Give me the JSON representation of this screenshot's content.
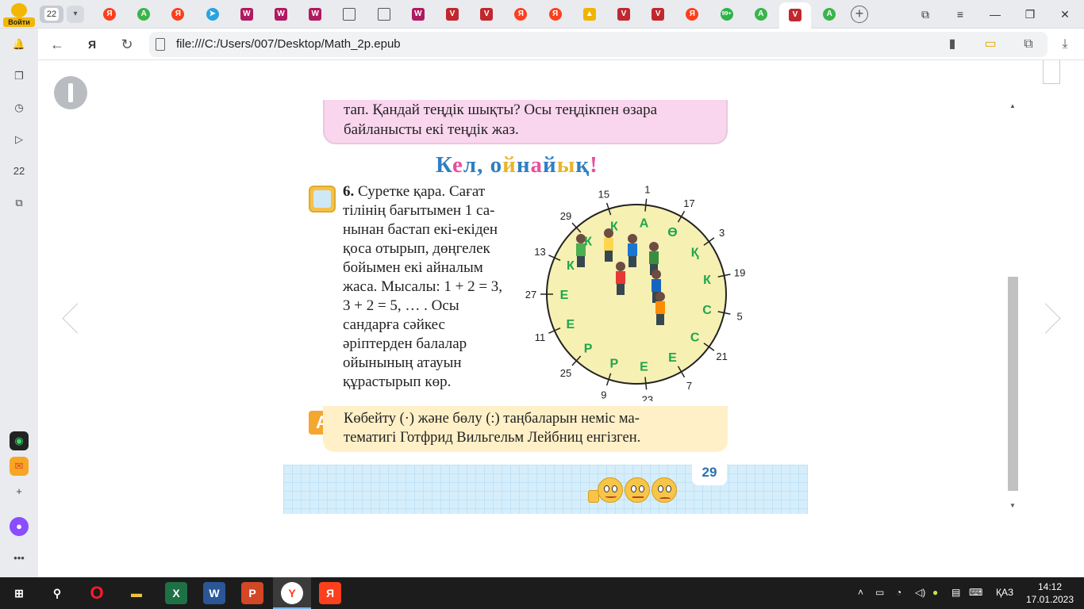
{
  "browser": {
    "login_label": "Войти",
    "tab_count": "22",
    "url": "file:///C:/Users/007/Desktop/Math_2p.epub"
  },
  "tabs": [
    {
      "icon": "yandex-icon",
      "glyph": "Я"
    },
    {
      "icon": "green-a-icon",
      "glyph": "A"
    },
    {
      "icon": "yandex-icon",
      "glyph": "Я"
    },
    {
      "icon": "telegram-icon",
      "glyph": "➤"
    },
    {
      "icon": "magenta-doc-icon",
      "glyph": "W"
    },
    {
      "icon": "magenta-doc-icon",
      "glyph": "W"
    },
    {
      "icon": "magenta-doc-icon",
      "glyph": "W"
    },
    {
      "icon": "document-icon",
      "glyph": ""
    },
    {
      "icon": "document-icon",
      "glyph": ""
    },
    {
      "icon": "magenta-doc-icon",
      "glyph": "W"
    },
    {
      "icon": "red-shield-icon",
      "glyph": "V"
    },
    {
      "icon": "red-shield-icon",
      "glyph": "V"
    },
    {
      "icon": "yandex-icon",
      "glyph": "Я"
    },
    {
      "icon": "yandex-icon",
      "glyph": "Я"
    },
    {
      "icon": "image-icon",
      "glyph": "▲"
    },
    {
      "icon": "red-shield-icon",
      "glyph": "V"
    },
    {
      "icon": "red-shield-icon",
      "glyph": "V"
    },
    {
      "icon": "yandex-icon",
      "glyph": "Я"
    },
    {
      "icon": "whatsapp-icon",
      "glyph": "99+"
    },
    {
      "icon": "green-a-icon",
      "glyph": "A"
    },
    {
      "icon": "red-shield-icon",
      "glyph": "V",
      "active": true
    },
    {
      "icon": "green-a-icon",
      "glyph": "A"
    }
  ],
  "sidebar": {
    "items": [
      {
        "icon": "bell-icon",
        "glyph": "🔔"
      },
      {
        "icon": "collections-icon",
        "glyph": "❐"
      },
      {
        "icon": "history-icon",
        "glyph": "◷"
      },
      {
        "icon": "play-icon",
        "glyph": "▷"
      },
      {
        "icon": "tabs-count-icon",
        "glyph": "22"
      },
      {
        "icon": "screenshot-icon",
        "glyph": "⧉"
      }
    ],
    "bottom": [
      {
        "icon": "app-icon",
        "glyph": "◉"
      },
      {
        "icon": "mail-icon",
        "glyph": "✉"
      },
      {
        "icon": "add-icon",
        "glyph": "+"
      },
      {
        "icon": "alice-icon",
        "glyph": "●"
      },
      {
        "icon": "more-icon",
        "glyph": "•••"
      }
    ]
  },
  "book": {
    "pink_box": {
      "line1": "тап. Қандай теңдік шықты? Осы теңдікпен өзара",
      "line2": "байланысты екі теңдік жаз."
    },
    "task_title": "Кел, ойнайық!",
    "task_number": "6.",
    "task_lines": [
      "Суретке қара. Сағат",
      "тілінің бағытымен 1 са-",
      "нынан бастап екі-екіден",
      "қоса отырып, дөңгелек",
      "бойымен екі айналым",
      "жаса. Мысалы: 1 + 2 = 3,",
      " 3 + 2 = 5, … . Осы",
      "сандарға сәйкес",
      "әріптерден балалар",
      "ойынының атауын",
      "құрастырып көр."
    ],
    "wheel": {
      "numbers": [
        "1",
        "17",
        "3",
        "19",
        "5",
        "21",
        "7",
        "23",
        "9",
        "25",
        "11",
        "27",
        "13",
        "29",
        "15"
      ],
      "letters": [
        "А",
        "Ө",
        "Қ",
        "К",
        "С",
        "С",
        "Е",
        "Е",
        "Р",
        "Р",
        "Е",
        "Е",
        "К",
        "К",
        "К"
      ]
    },
    "fact_icon": "A",
    "fact_lines": [
      "Көбейту (·) және бөлу (:) таңбаларын неміс ма-",
      "тематигі Готфрид Вильгельм Лейбниц енгізген."
    ],
    "page_number": "29"
  },
  "taskbar": {
    "lang": "ҚАЗ",
    "time": "14:12",
    "date": "17.01.2023"
  },
  "colors": {
    "tab_strip": "#e9ebef",
    "pink_box": "#f9d6ee",
    "fact_box": "#fff0c7",
    "footer_grid": "#d6eefb",
    "letter_green": "#1fa64a",
    "title_blue": "#2f7fc1"
  }
}
